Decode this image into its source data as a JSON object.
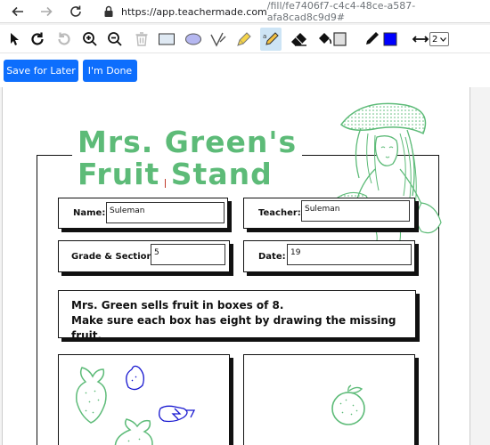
{
  "browser": {
    "url_host": "https://app.teachermade.com",
    "url_path": "/fill/fe7406f7-c4c4-48ce-a587-afa8cad8c9d9#"
  },
  "toolbar": {
    "tools": [
      "select-tool",
      "undo-tool",
      "redo-tool",
      "zoom-in-tool",
      "zoom-out-tool",
      "delete-tool",
      "rectangle-tool",
      "ellipse-tool",
      "check-tool",
      "highlighter-tool",
      "text-tool",
      "eraser-tool",
      "fill-tool",
      "pen-tool",
      "stroke-width-tool"
    ],
    "active_tool": "text-tool",
    "pen_color": "#0000ff",
    "fill_color": "#e0e0e0",
    "stroke_width": "2"
  },
  "actions": {
    "save_label": "Save for Later",
    "done_label": "I'm Done"
  },
  "worksheet": {
    "title_line1": "Mrs. Green's",
    "title_line2": "Fruit Stand",
    "title_color": "#5dbb78",
    "name_label": "Name:",
    "name_value": "Suleman",
    "teacher_label": "Teacher:",
    "teacher_value": "Suleman",
    "grade_label": "Grade & Section:",
    "grade_value": "5",
    "date_label": "Date:",
    "date_value": "19",
    "instruction_line1": "Mrs. Green sells fruit in boxes of 8.",
    "instruction_line2": "Make sure each box has eight by drawing the missing fruit."
  }
}
